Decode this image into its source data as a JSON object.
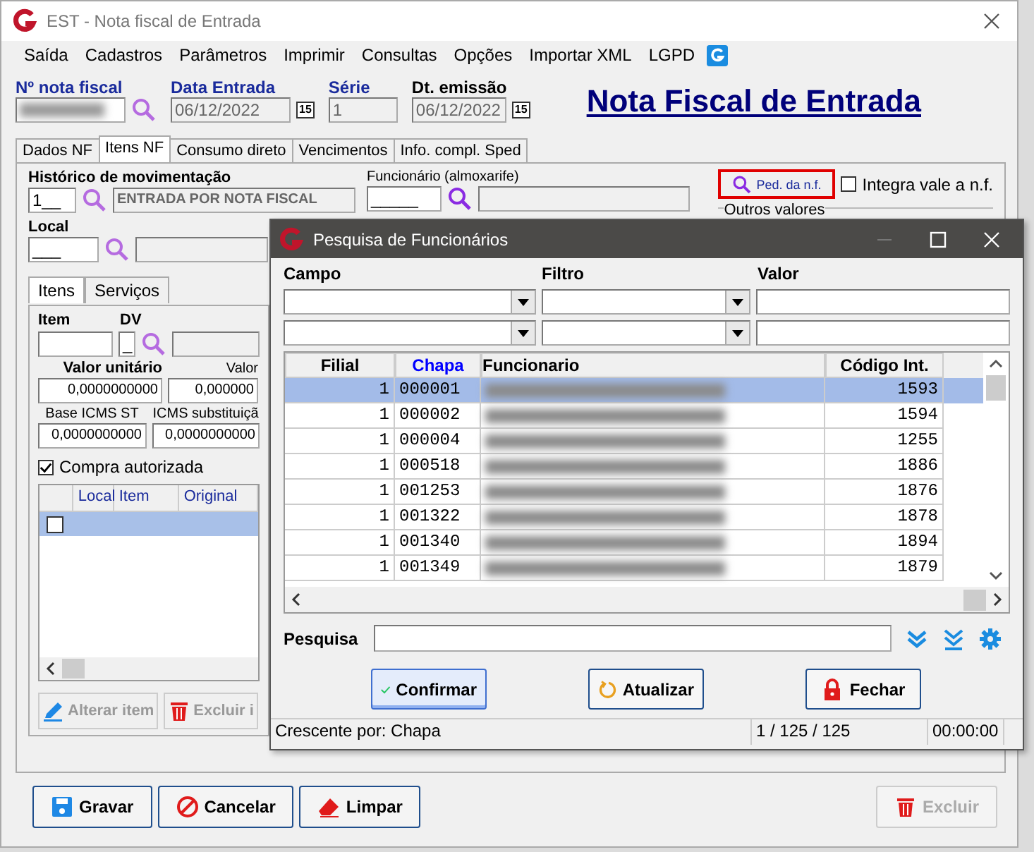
{
  "window": {
    "title": "EST - Nota fiscal de Entrada"
  },
  "menu": [
    "Saída",
    "Cadastros",
    "Parâmetros",
    "Imprimir",
    "Consultas",
    "Opções",
    "Importar XML",
    "LGPD"
  ],
  "header": {
    "nota_fiscal": {
      "label": "Nº nota fiscal",
      "redacted": true
    },
    "data_entrada": {
      "label": "Data Entrada",
      "value": "06/12/2022",
      "calendar": "15"
    },
    "serie": {
      "label": "Série",
      "value": "1"
    },
    "dt_emissao": {
      "label": "Dt. emissão",
      "value": "06/12/2022",
      "calendar": "15"
    },
    "page_title": "Nota Fiscal de Entrada"
  },
  "tabs": [
    {
      "label": "Dados NF",
      "selected": false
    },
    {
      "label": "Itens NF",
      "selected": true
    },
    {
      "label": "Consumo direto",
      "selected": false
    },
    {
      "label": "Vencimentos",
      "selected": false
    },
    {
      "label": "Info. compl. Sped",
      "selected": false
    }
  ],
  "itens_nf": {
    "historico": {
      "label": "Histórico de movimentação",
      "code": "1__",
      "description": "ENTRADA POR NOTA FISCAL"
    },
    "funcionario": {
      "label": "Funcionário (almoxarife)",
      "code": "_____"
    },
    "ped_button": {
      "label": "Ped. da n.f.",
      "highlighted": true
    },
    "integra": {
      "label": "Integra vale a n.f.",
      "checked": false
    },
    "outros_valores": "Outros valores",
    "local": {
      "label": "Local",
      "code": "___"
    },
    "sub_tabs": [
      {
        "label": "Itens",
        "selected": true
      },
      {
        "label": "Serviços",
        "selected": false
      }
    ],
    "item": {
      "label": "Item",
      "dv_label": "DV",
      "dv": "_"
    },
    "valores": [
      {
        "label": "Valor unitário",
        "value": "0,0000000000",
        "bold": true
      },
      {
        "label": "Valor",
        "value": "0,000000",
        "bold": false
      }
    ],
    "icms": [
      {
        "label": "Base ICMS ST",
        "value": "0,0000000000"
      },
      {
        "label": "ICMS substituiçã",
        "value": "0,0000000000"
      }
    ],
    "compra": {
      "label": "Compra autorizada",
      "checked": true
    },
    "grid": {
      "columns": [
        "Local",
        "Item",
        "Original"
      ],
      "rows": [
        {
          "selected": true,
          "checked": false
        }
      ]
    },
    "item_buttons": [
      {
        "label": "Alterar item",
        "kind": "edit",
        "disabled": true
      },
      {
        "label": "Excluir i",
        "kind": "delete",
        "disabled": true
      }
    ]
  },
  "footer_buttons": [
    {
      "label": "Gravar",
      "kind": "save",
      "disabled": false
    },
    {
      "label": "Cancelar",
      "kind": "cancel",
      "disabled": false
    },
    {
      "label": "Limpar",
      "kind": "clear",
      "disabled": false
    },
    {
      "label": "Excluir",
      "kind": "delete",
      "disabled": true
    }
  ],
  "dialog": {
    "title": "Pesquisa de Funcionários",
    "filter_labels": [
      "Campo",
      "Filtro",
      "Valor"
    ],
    "table": {
      "columns": [
        {
          "label": "Filial",
          "sorted": false
        },
        {
          "label": "Chapa",
          "sorted": true
        },
        {
          "label": "Funcionario",
          "sorted": false
        },
        {
          "label": "Código Int.",
          "sorted": false
        }
      ],
      "rows": [
        {
          "filial": "1",
          "chapa": "000001",
          "name_redacted": true,
          "codigo": "1593",
          "selected": true
        },
        {
          "filial": "1",
          "chapa": "000002",
          "name_redacted": true,
          "codigo": "1594",
          "selected": false
        },
        {
          "filial": "1",
          "chapa": "000004",
          "name_redacted": true,
          "codigo": "1255",
          "selected": false
        },
        {
          "filial": "1",
          "chapa": "000518",
          "name_redacted": true,
          "codigo": "1886",
          "selected": false
        },
        {
          "filial": "1",
          "chapa": "001253",
          "name_redacted": true,
          "codigo": "1876",
          "selected": false
        },
        {
          "filial": "1",
          "chapa": "001322",
          "name_redacted": true,
          "codigo": "1878",
          "selected": false
        },
        {
          "filial": "1",
          "chapa": "001340",
          "name_redacted": true,
          "codigo": "1894",
          "selected": false
        },
        {
          "filial": "1",
          "chapa": "001349",
          "name_redacted": true,
          "codigo": "1879",
          "selected": false
        }
      ]
    },
    "search_label": "Pesquisa",
    "buttons": [
      {
        "label": "Confirmar",
        "kind": "confirm",
        "focused": true
      },
      {
        "label": "Atualizar",
        "kind": "refresh",
        "focused": false
      },
      {
        "label": "Fechar",
        "kind": "close",
        "focused": false
      }
    ],
    "status": [
      "Crescente por: Chapa",
      "1 / 125 / 125",
      "00:00:00"
    ]
  }
}
